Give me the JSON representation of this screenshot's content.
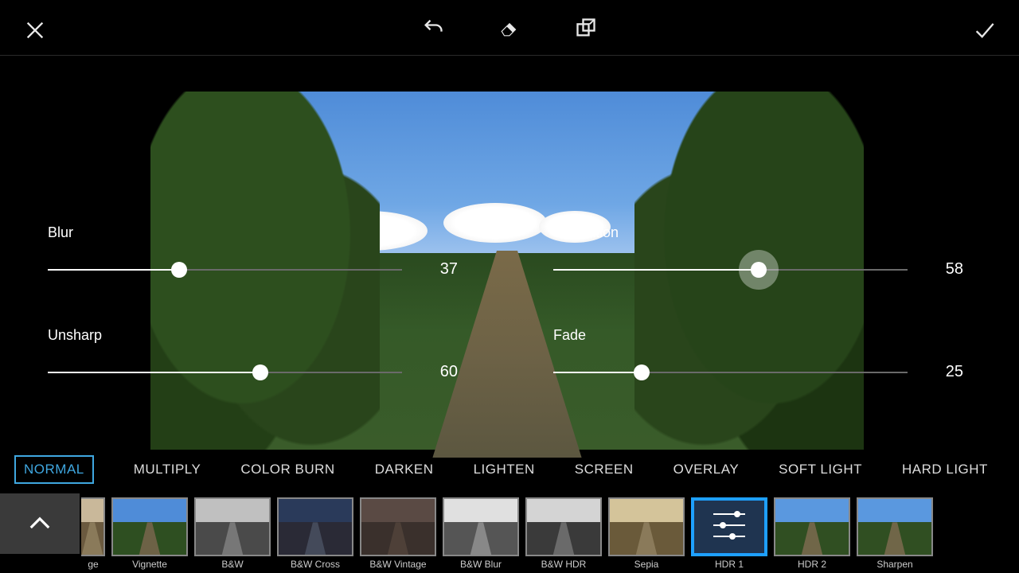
{
  "toolbar": {
    "cancel_icon": "close-icon",
    "undo_icon": "undo-icon",
    "eraser_icon": "eraser-icon",
    "compare_icon": "compare-icon",
    "apply_icon": "checkmark-icon"
  },
  "sliders": {
    "blur": {
      "label": "Blur",
      "value": 37,
      "max": 100
    },
    "saturation": {
      "label": "Saturation",
      "value": 58,
      "max": 100,
      "active": true
    },
    "unsharp": {
      "label": "Unsharp",
      "value": 60,
      "max": 100
    },
    "fade": {
      "label": "Fade",
      "value": 25,
      "max": 100
    }
  },
  "blend_modes": {
    "selected_index": 0,
    "items": [
      "NORMAL",
      "MULTIPLY",
      "COLOR BURN",
      "DARKEN",
      "LIGHTEN",
      "SCREEN",
      "OVERLAY",
      "SOFT LIGHT",
      "HARD LIGHT"
    ]
  },
  "filters": {
    "selected_index": 8,
    "items": [
      {
        "name": "Vintage",
        "partial": true,
        "sky": "#c9b89a",
        "ground": "#6b5a3f",
        "river": "#8a7a5a"
      },
      {
        "name": "Vignette",
        "sky": "#4f8cd8",
        "ground": "#2e4f21",
        "river": "#6d6246"
      },
      {
        "name": "B&W",
        "sky": "#c0c0c0",
        "ground": "#4a4a4a",
        "river": "#777"
      },
      {
        "name": "B&W Cross",
        "sky": "#2a3a5a",
        "ground": "#2a2a36",
        "river": "#444a5a"
      },
      {
        "name": "B&W Vintage",
        "sky": "#5a4a44",
        "ground": "#3a302c",
        "river": "#4e4038"
      },
      {
        "name": "B&W Blur",
        "sky": "#e0e0e0",
        "ground": "#555",
        "river": "#888"
      },
      {
        "name": "B&W HDR",
        "sky": "#d4d4d4",
        "ground": "#3a3a3a",
        "river": "#6a6a6a"
      },
      {
        "name": "Sepia",
        "sky": "#d4c49a",
        "ground": "#6a5a3a",
        "river": "#8a7a5a"
      },
      {
        "name": "HDR 1",
        "sky": "#3a5a8a",
        "ground": "#1f3416",
        "river": "#3a4030",
        "hdr_icon": true
      },
      {
        "name": "HDR 2",
        "sky": "#5a98df",
        "ground": "#304f22",
        "river": "#706648"
      },
      {
        "name": "Sharpen",
        "sky": "#5a98df",
        "ground": "#304f22",
        "river": "#706648"
      }
    ]
  }
}
